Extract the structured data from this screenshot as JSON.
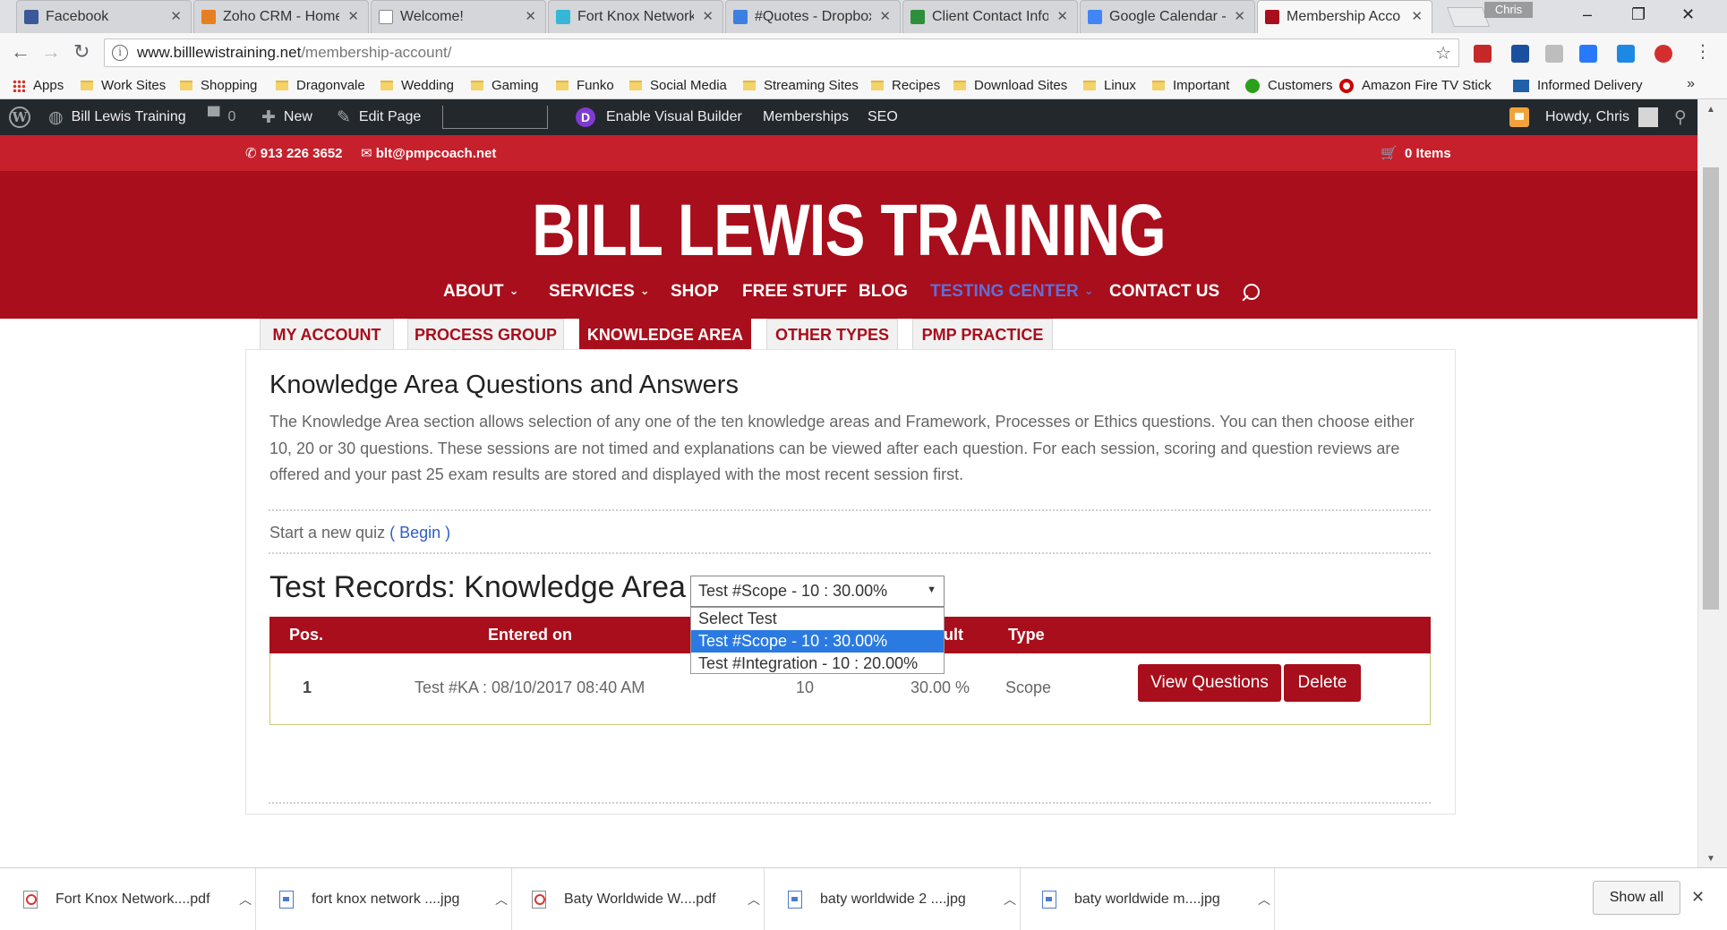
{
  "browser": {
    "tabs": [
      {
        "label": "Facebook",
        "color": "#3b5998"
      },
      {
        "label": "Zoho CRM - Home",
        "color": "#e67e22"
      },
      {
        "label": "Welcome!",
        "color": "#ffffff"
      },
      {
        "label": "Fort Knox Network",
        "color": "#35b7d6"
      },
      {
        "label": "#Quotes - Dropbox",
        "color": "#3d7fe0"
      },
      {
        "label": "Client Contact Info",
        "color": "#2d8f3c"
      },
      {
        "label": "Google Calendar -",
        "color": "#4285f4"
      },
      {
        "label": "Membership Acco",
        "color": "#a80e1b"
      }
    ],
    "user_chip": "Chris",
    "url_host": "www.billlewistraining.net",
    "url_path": "/membership-account/"
  },
  "bookmarks": [
    {
      "label": "Apps",
      "kind": "apps"
    },
    {
      "label": "Work Sites",
      "kind": "folder"
    },
    {
      "label": "Shopping",
      "kind": "folder"
    },
    {
      "label": "Dragonvale",
      "kind": "folder"
    },
    {
      "label": "Wedding",
      "kind": "folder"
    },
    {
      "label": "Gaming",
      "kind": "folder"
    },
    {
      "label": "Funko",
      "kind": "folder"
    },
    {
      "label": "Social Media",
      "kind": "folder"
    },
    {
      "label": "Streaming Sites",
      "kind": "folder"
    },
    {
      "label": "Recipes",
      "kind": "folder"
    },
    {
      "label": "Download Sites",
      "kind": "folder"
    },
    {
      "label": "Linux",
      "kind": "folder"
    },
    {
      "label": "Important",
      "kind": "folder"
    },
    {
      "label": "Customers",
      "kind": "qb"
    },
    {
      "label": "Amazon Fire TV Stick",
      "kind": "target"
    },
    {
      "label": "Informed Delivery",
      "kind": "usps"
    }
  ],
  "adminbar": {
    "site_name": "Bill Lewis Training",
    "comments_count": "0",
    "new_label": "New",
    "edit_label": "Edit Page",
    "visual_builder_label": "Enable Visual Builder",
    "memberships_label": "Memberships",
    "seo_label": "SEO",
    "howdy": "Howdy, Chris"
  },
  "topbar": {
    "phone": "913 226 3652",
    "email": "blt@pmpcoach.net",
    "cart": "0 Items"
  },
  "site": {
    "logo": "BILL LEWIS TRAINING",
    "nav": [
      {
        "label": "ABOUT",
        "dropdown": true
      },
      {
        "label": "SERVICES",
        "dropdown": true
      },
      {
        "label": "SHOP",
        "dropdown": false
      },
      {
        "label": "FREE STUFF",
        "dropdown": false
      },
      {
        "label": "BLOG",
        "dropdown": false
      },
      {
        "label": "TESTING CENTER",
        "dropdown": true
      },
      {
        "label": "CONTACT US",
        "dropdown": false
      }
    ]
  },
  "subtabs": [
    "MY ACCOUNT",
    "PROCESS GROUP",
    "KNOWLEDGE AREA",
    "OTHER TYPES",
    "PMP PRACTICE"
  ],
  "content": {
    "title": "Knowledge Area Questions and Answers",
    "description": "The Knowledge Area section allows selection of any one of the ten knowledge areas and Framework, Processes or Ethics questions. You can then choose either 10, 20 or 30 questions. These sessions are not timed and explanations can be viewed after each question. For each session, scoring and question reviews are offered and your past 25 exam results are stored and displayed with the most recent session first.",
    "start_text": "Start a new quiz",
    "begin_link": "( Begin )",
    "records_title": "Test Records: Knowledge Area",
    "select_value": "Test #Scope - 10 : 30.00%",
    "select_options": [
      "Select Test",
      "Test #Scope - 10 : 30.00%",
      "Test #Integration - 10 : 20.00%"
    ],
    "table_headers": [
      "Pos.",
      "Entered on",
      "ult",
      "Type"
    ],
    "row": {
      "pos": "1",
      "entered": "Test #KA : 08/10/2017 08:40 AM",
      "questions": "10",
      "result": "30.00 %",
      "type": "Scope"
    },
    "view_button": "View Questions",
    "delete_button": "Delete"
  },
  "downloads": [
    {
      "name": "Fort Knox Network....pdf",
      "kind": "pdf"
    },
    {
      "name": "fort knox network ....jpg",
      "kind": "img"
    },
    {
      "name": "Baty Worldwide W....pdf",
      "kind": "pdf"
    },
    {
      "name": "baty worldwide 2 ....jpg",
      "kind": "img"
    },
    {
      "name": "baty worldwide m....jpg",
      "kind": "img"
    }
  ],
  "show_all": "Show all",
  "colors": {
    "brand_red": "#a80e1b",
    "topbar_red": "#c6202c",
    "link_blue": "#2f5ec4"
  }
}
